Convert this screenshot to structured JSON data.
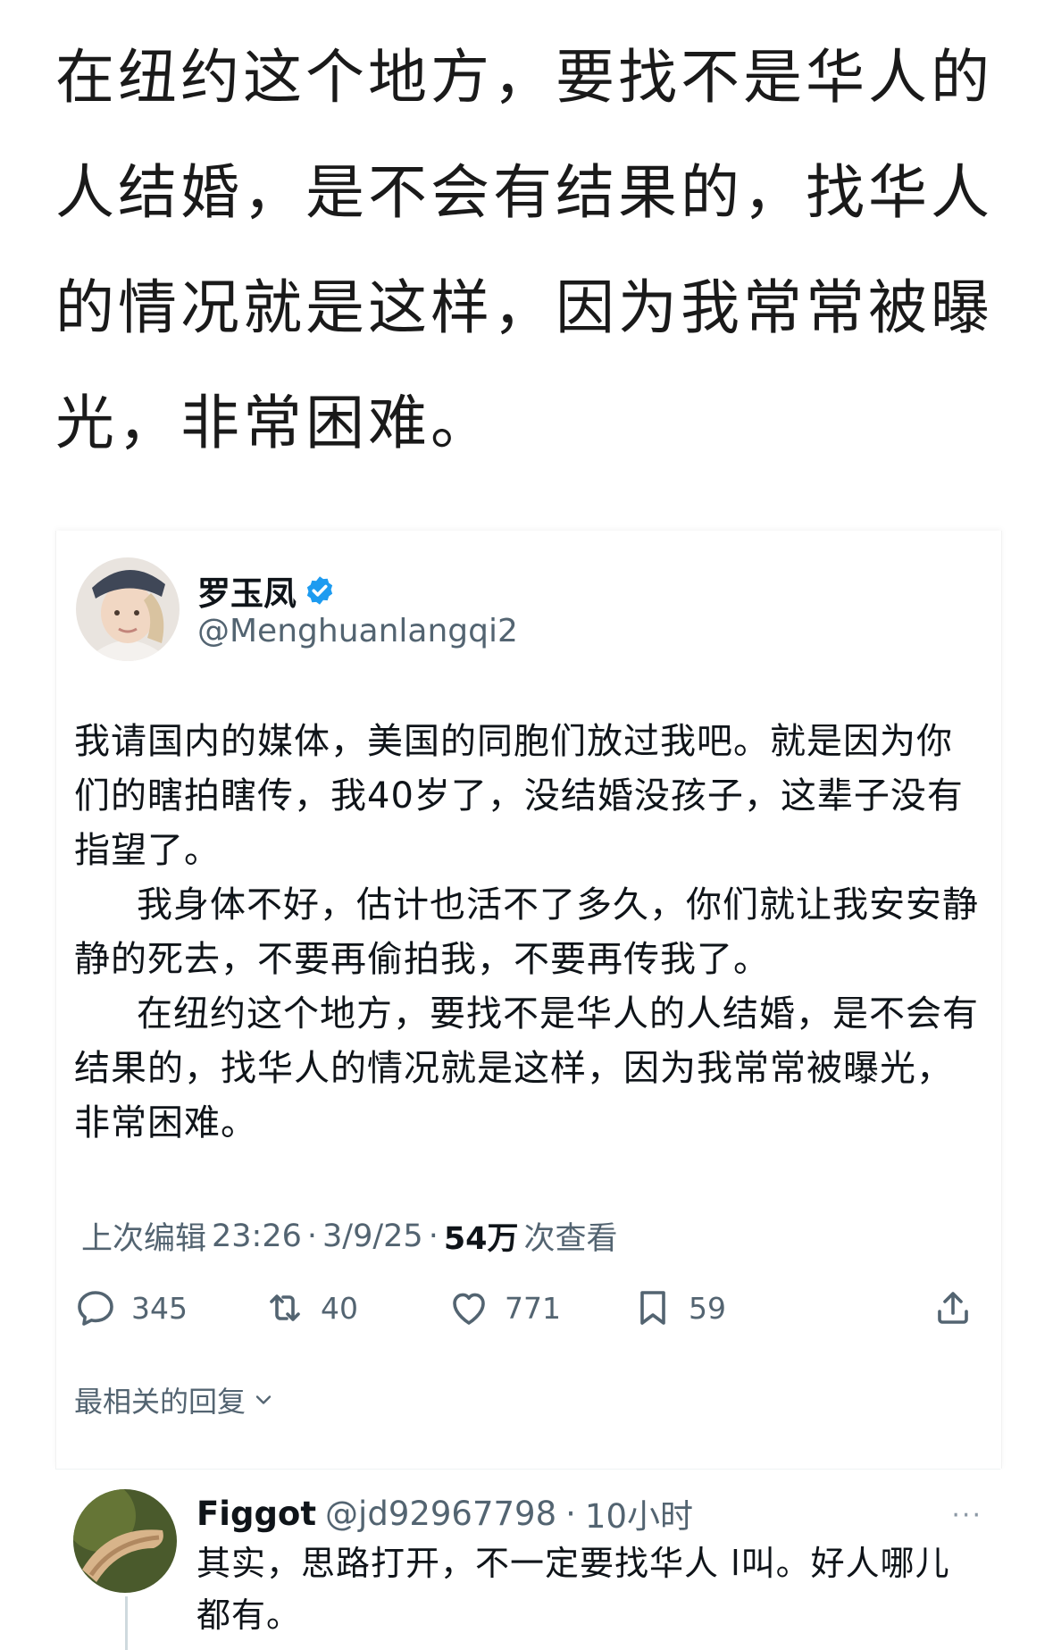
{
  "intro": {
    "text": "在纽约这个地方，要找不是华人的人结婚，是不会有结果的，找华人的情况就是这样，因为我常常被曝光，非常困难。"
  },
  "tweet": {
    "display_name": "罗玉凤",
    "handle": "@Menghuanlangqi2",
    "verified_icon": "verified-badge-icon",
    "paragraphs": [
      "我请国内的媒体，美国的同胞们放过我吧。就是因为你们的瞎拍瞎传，我40岁了，没结婚没孩子，这辈子没有指望了。",
      "我身体不好，估计也活不了多久，你们就让我安安静静的死去，不要再偷拍我，不要再传我了。",
      "在纽约这个地方，要找不是华人的人结婚，是不会有结果的，找华人的情况就是这样，因为我常常被曝光，非常困难。"
    ],
    "meta": {
      "edited_label": "上次编辑",
      "time": "23:26",
      "sep1": "·",
      "date": "3/9/25",
      "sep2": "·",
      "views_count": "54万",
      "views_label": "次查看"
    },
    "actions": {
      "reply_count": "345",
      "retweet_count": "40",
      "like_count": "771",
      "bookmark_count": "59"
    },
    "sort_label": "最相关的回复"
  },
  "reply": {
    "name": "Figgot",
    "handle": "@jd92967798",
    "sep": "·",
    "time": "10小时",
    "more": "···",
    "text": "其实，思路打开，不一定要找华人 l叫。好人哪儿都有。"
  },
  "colors": {
    "verified_blue": "#1d9bf0",
    "secondary_text": "#536471",
    "primary_text": "#0f1419"
  }
}
